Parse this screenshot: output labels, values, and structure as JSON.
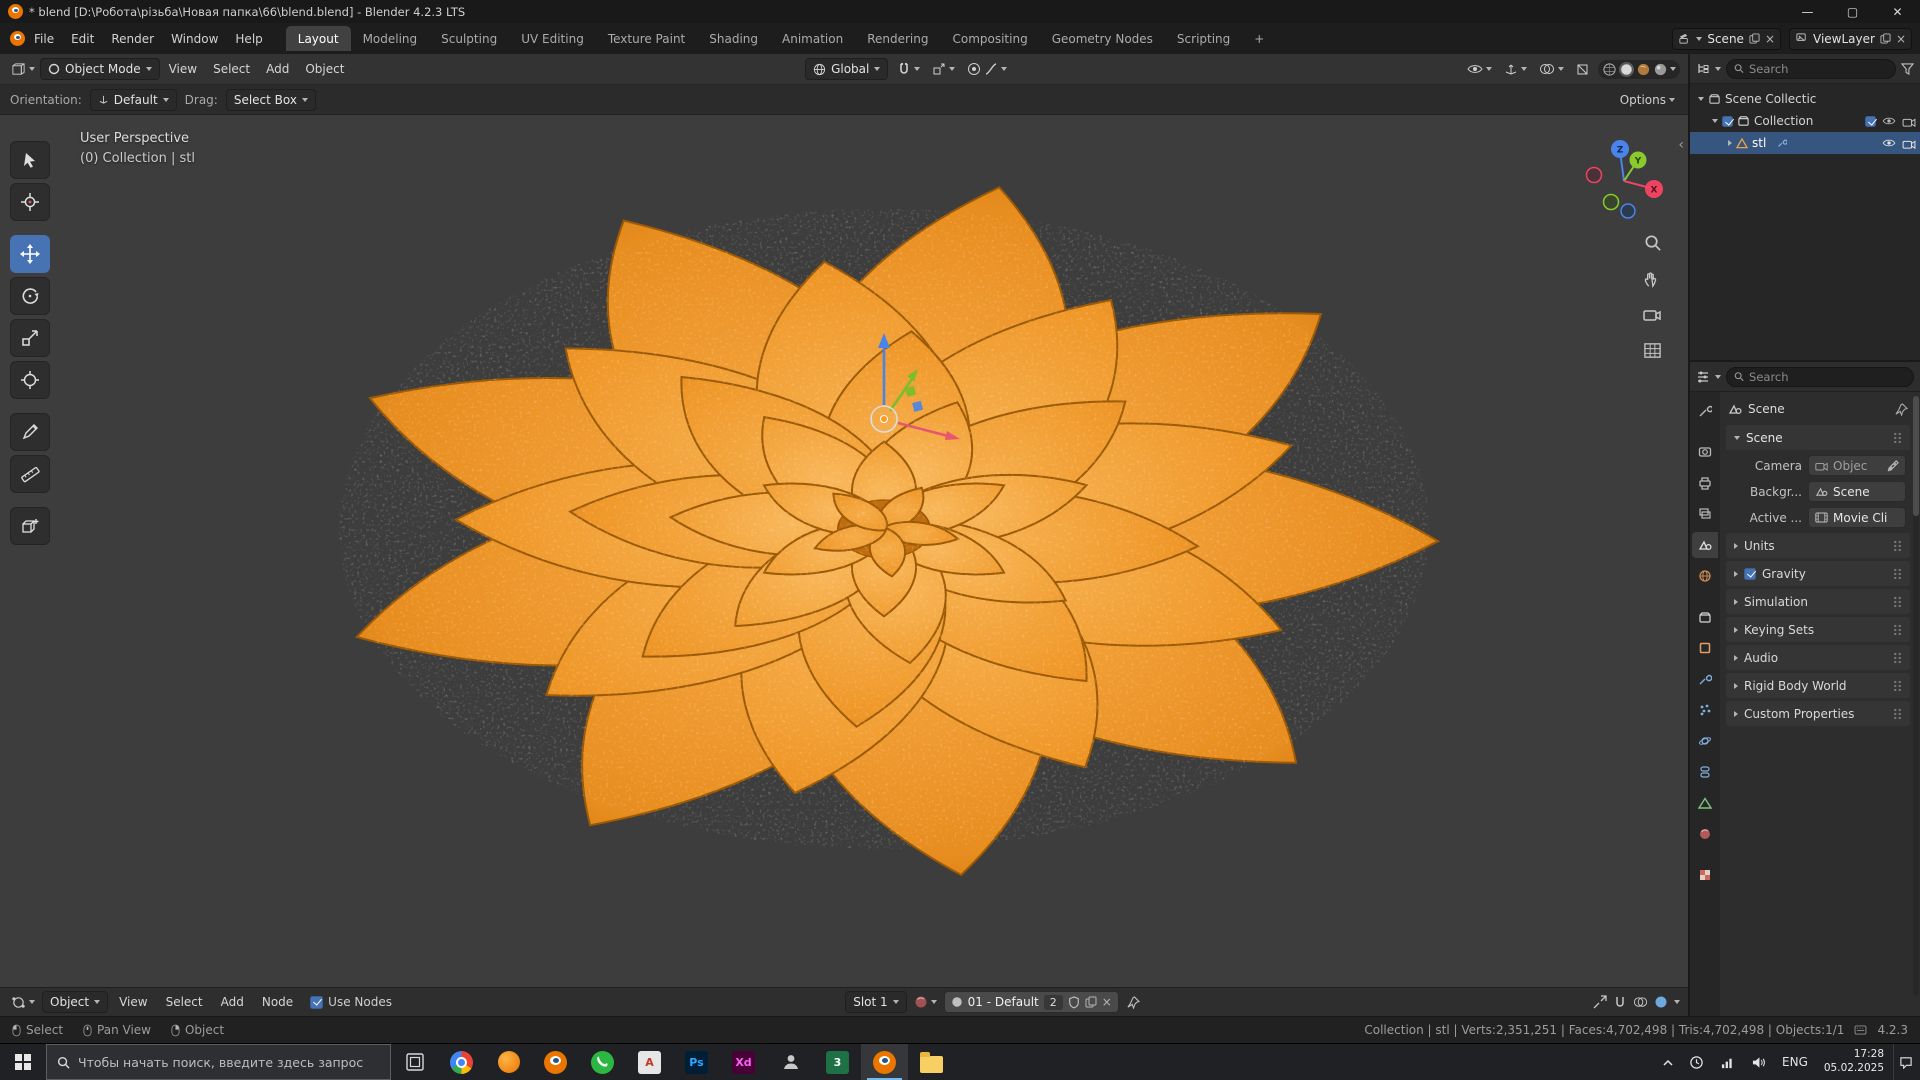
{
  "window": {
    "title": "* blend [D:\\Робота\\різьба\\Новая папка\\66\\blend.blend] - Blender 4.2.3 LTS"
  },
  "topbar": {
    "menus": [
      "File",
      "Edit",
      "Render",
      "Window",
      "Help"
    ],
    "workspaces": [
      "Layout",
      "Modeling",
      "Sculpting",
      "UV Editing",
      "Texture Paint",
      "Shading",
      "Animation",
      "Rendering",
      "Compositing",
      "Geometry Nodes",
      "Scripting"
    ],
    "add_workspace": "+",
    "scene_name": "Scene",
    "viewlayer_name": "ViewLayer"
  },
  "viewport_header": {
    "mode": "Object Mode",
    "menus": [
      "View",
      "Select",
      "Add",
      "Object"
    ],
    "orientation": "Global"
  },
  "tool_settings": {
    "orientation_label": "Orientation:",
    "orientation_value": "Default",
    "drag_label": "Drag:",
    "drag_value": "Select Box",
    "options_label": "Options"
  },
  "viewport": {
    "overlay_line1": "User Perspective",
    "overlay_line2": "(0) Collection | stl",
    "axis": {
      "x": "X",
      "y": "Y",
      "z": "Z"
    },
    "model_color": "#ee9320"
  },
  "outliner": {
    "search_placeholder": "Search",
    "rows": [
      {
        "label": "Scene Collectic"
      },
      {
        "label": "Collection"
      },
      {
        "label": "stl"
      }
    ]
  },
  "properties": {
    "search_placeholder": "Search",
    "breadcrumb": "Scene",
    "scene_panel": {
      "title": "Scene",
      "camera_label": "Camera",
      "camera_value": "Objec",
      "background_label": "Backgr...",
      "background_value": "Scene",
      "active_clip_label": "Active ...",
      "active_clip_value": "Movie Cli"
    },
    "sections": [
      "Units",
      "Gravity",
      "Simulation",
      "Keying Sets",
      "Audio",
      "Rigid Body World",
      "Custom Properties"
    ]
  },
  "shader_editor": {
    "id_type": "Object",
    "menus": [
      "View",
      "Select",
      "Add",
      "Node"
    ],
    "use_nodes_label": "Use Nodes",
    "slot": "Slot 1",
    "material_name": "01 - Default",
    "users_count": "2"
  },
  "statusbar": {
    "hints": [
      "Select",
      "Pan View",
      "Object"
    ],
    "stats": "Collection | stl | Verts:2,351,251 | Faces:4,702,498 | Tris:4,702,498 | Objects:1/1",
    "version": "4.2.3"
  },
  "taskbar": {
    "search_placeholder": "Чтобы начать поиск, введите здесь запрос",
    "app_labels": {
      "autodesk": "A",
      "photoshop": "Ps",
      "xd": "Xd",
      "excel": "3"
    },
    "language": "ENG",
    "time": "17:28",
    "date": "05.02.2025"
  },
  "colors": {
    "accent": "#4772b3",
    "selection": "#36557f",
    "model_orange": "#ee9320"
  }
}
